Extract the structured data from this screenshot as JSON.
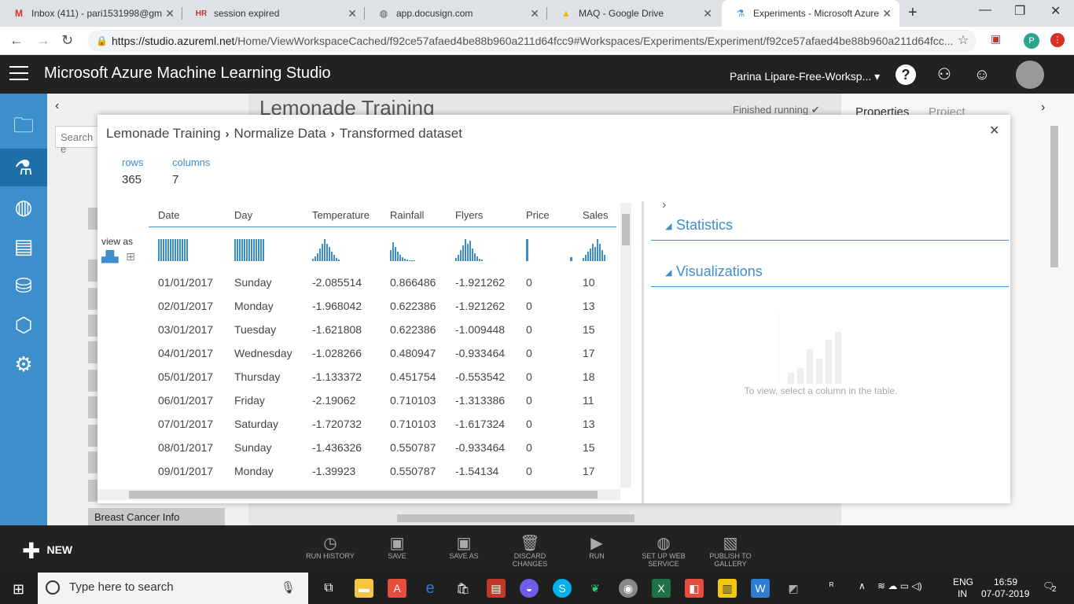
{
  "browser": {
    "tabs": [
      {
        "title": "Inbox (411) - pari1531998@gm",
        "icon": "gmail-icon",
        "glyph": "M",
        "color": "#d93025"
      },
      {
        "title": "session expired",
        "icon": "hr-icon",
        "glyph": "HR",
        "color": "#c0392b"
      },
      {
        "title": "app.docusign.com",
        "icon": "globe-icon",
        "glyph": "◍",
        "color": "#555555"
      },
      {
        "title": "MAQ - Google Drive",
        "icon": "drive-icon",
        "glyph": "▲",
        "color": "#f4b400"
      },
      {
        "title": "Experiments - Microsoft Azure",
        "icon": "flask-icon",
        "glyph": "⚗",
        "color": "#3d8fcc"
      }
    ],
    "url_host": "https://studio.azureml.net",
    "url_path": "/Home/ViewWorkspaceCached/f92ce57afaed4be88b960a211d64fcc9#Workspaces/Experiments/Experiment/f92ce57afaed4be88b960a211d64fcc..."
  },
  "app": {
    "title": "Microsoft Azure Machine Learning Studio",
    "workspace": "Parina Lipare-Free-Worksp... ▾"
  },
  "background": {
    "experiment_title": "Lemonade Training",
    "status": "Finished running ✔",
    "properties_tab": "Properties",
    "project_tab": "Project",
    "search_placeholder": "Search e",
    "breast_cancer": "Breast Cancer Info"
  },
  "modal": {
    "crumb1": "Lemonade Training",
    "crumb2": "Normalize Data",
    "crumb3": "Transformed dataset",
    "rows_label": "rows",
    "rows_value": "365",
    "columns_label": "columns",
    "columns_value": "7",
    "view_as": "view as",
    "columns": [
      "Date",
      "Day",
      "Temperature",
      "Rainfall",
      "Flyers",
      "Price",
      "Sales"
    ],
    "rows": [
      [
        "01/01/2017",
        "Sunday",
        "-2.085514",
        "0.866486",
        "-1.921262",
        "0",
        "10"
      ],
      [
        "02/01/2017",
        "Monday",
        "-1.968042",
        "0.622386",
        "-1.921262",
        "0",
        "13"
      ],
      [
        "03/01/2017",
        "Tuesday",
        "-1.621808",
        "0.622386",
        "-1.009448",
        "0",
        "15"
      ],
      [
        "04/01/2017",
        "Wednesday",
        "-1.028266",
        "0.480947",
        "-0.933464",
        "0",
        "17"
      ],
      [
        "05/01/2017",
        "Thursday",
        "-1.133372",
        "0.451754",
        "-0.553542",
        "0",
        "18"
      ],
      [
        "06/01/2017",
        "Friday",
        "-2.19062",
        "0.710103",
        "-1.313386",
        "0",
        "11"
      ],
      [
        "07/01/2017",
        "Saturday",
        "-1.720732",
        "0.710103",
        "-1.617324",
        "0",
        "13"
      ],
      [
        "08/01/2017",
        "Sunday",
        "-1.436326",
        "0.550787",
        "-0.933464",
        "0",
        "15"
      ],
      [
        "09/01/2017",
        "Monday",
        "-1.39923",
        "0.550787",
        "-1.54134",
        "0",
        "17"
      ]
    ],
    "statistics": "Statistics",
    "visualizations": "Visualizations",
    "viz_hint": "To view, select a column in the table."
  },
  "commands": {
    "new": "NEW",
    "run_history": "RUN HISTORY",
    "save": "SAVE",
    "save_as": "SAVE AS",
    "discard": "DISCARD CHANGES",
    "run": "RUN",
    "web_service": "SET UP WEB SERVICE",
    "publish": "PUBLISH TO GALLERY"
  },
  "taskbar": {
    "search_placeholder": "Type here to search",
    "lang1": "ENG",
    "lang2": "IN",
    "time": "16:59",
    "date": "07-07-2019",
    "notif": "2"
  },
  "colors": {
    "accent": "#3d8fcc",
    "header": "#222222"
  }
}
